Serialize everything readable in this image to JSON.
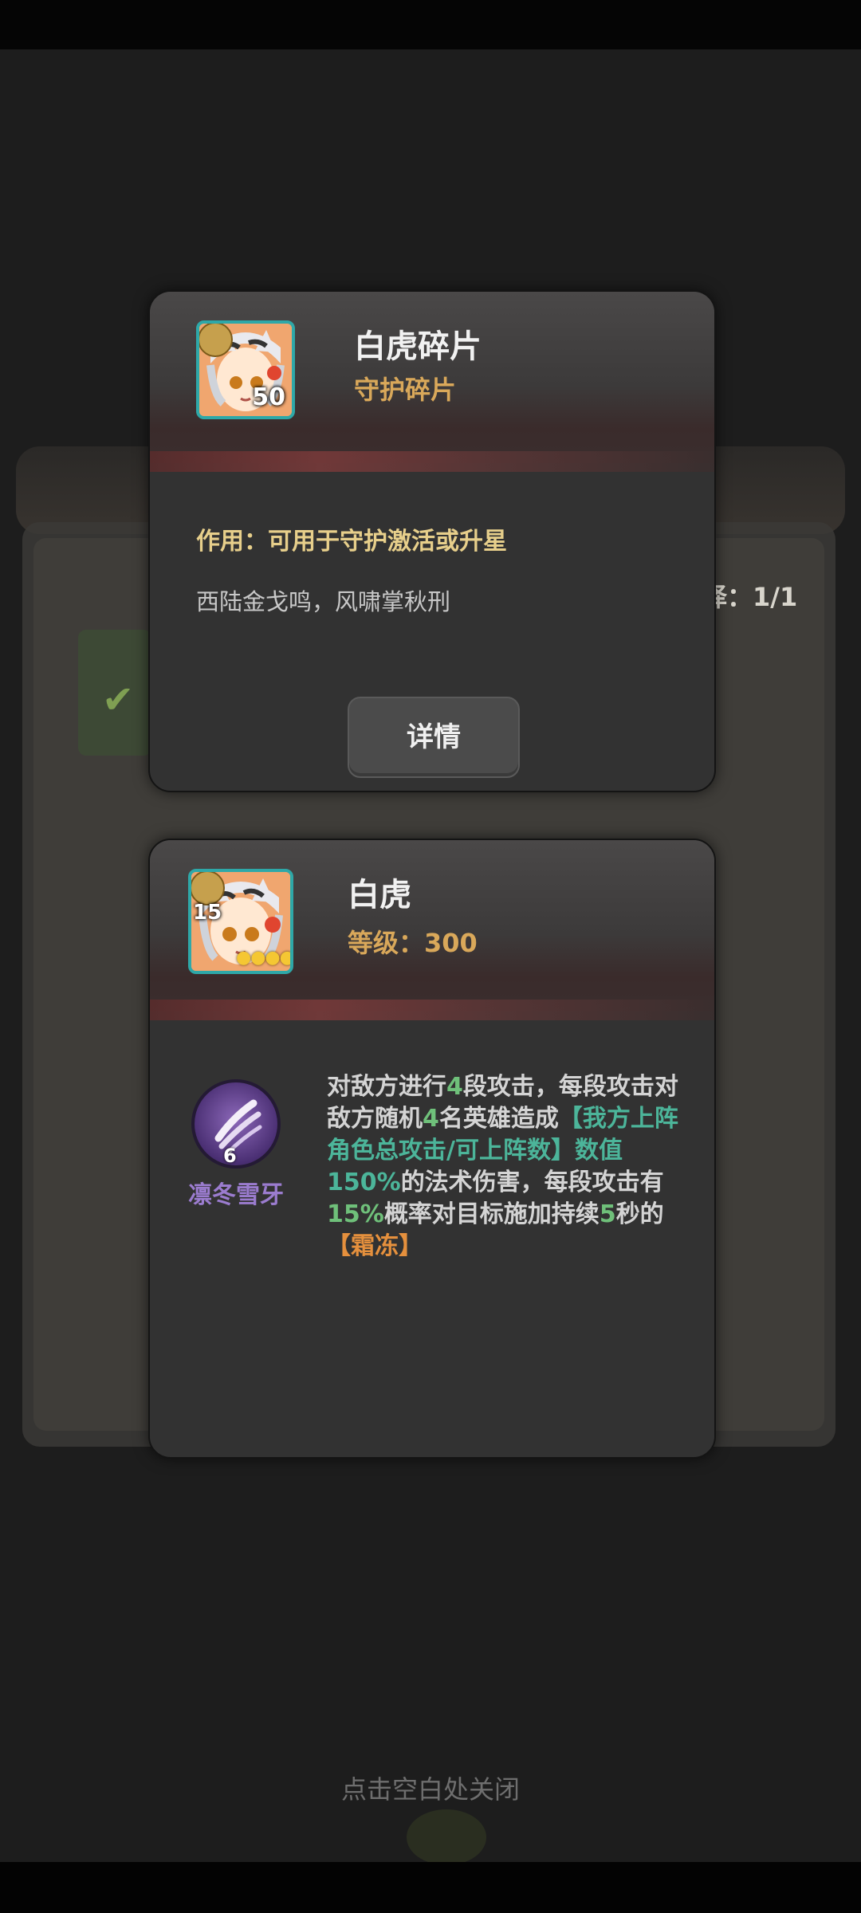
{
  "background": {
    "count_text": "择：1/1",
    "close_hint": "点击空白处关闭"
  },
  "item_card": {
    "name": "白虎碎片",
    "type": "守护碎片",
    "count": "50",
    "usage": "作用：可用于守护激活或升星",
    "flavor": "西陆金戈鸣，风啸掌秋刑",
    "detail_button": "详情"
  },
  "hero_card": {
    "name": "白虎",
    "level_text": "等级：300",
    "badge_level": "15",
    "stars": 5,
    "stars_text": "●●●●●",
    "skill": {
      "name": "凛冬雪牙",
      "level": "6",
      "icon": "claw-slash-icon",
      "desc": {
        "p1": "对敌方进行",
        "n1": "4",
        "p2": "段攻击，每段攻击对敌方随机",
        "n2": "4",
        "p3": "名英雄造成",
        "g1": "【我方上阵角色总攻击/可上阵数】数值150%",
        "p4": "的法术伤害，每段攻击有",
        "n3": "15%",
        "p5": "概率对目标施加持续",
        "n4": "5",
        "p6": "秒的",
        "o1": "【霜冻】"
      }
    }
  },
  "colors": {
    "accent_gold": "#d9a85a",
    "accent_teal": "#2ea8a8",
    "skill_purple": "#9b7ccf",
    "highlight_green": "#4cb59a",
    "highlight_orange": "#e5903d"
  }
}
